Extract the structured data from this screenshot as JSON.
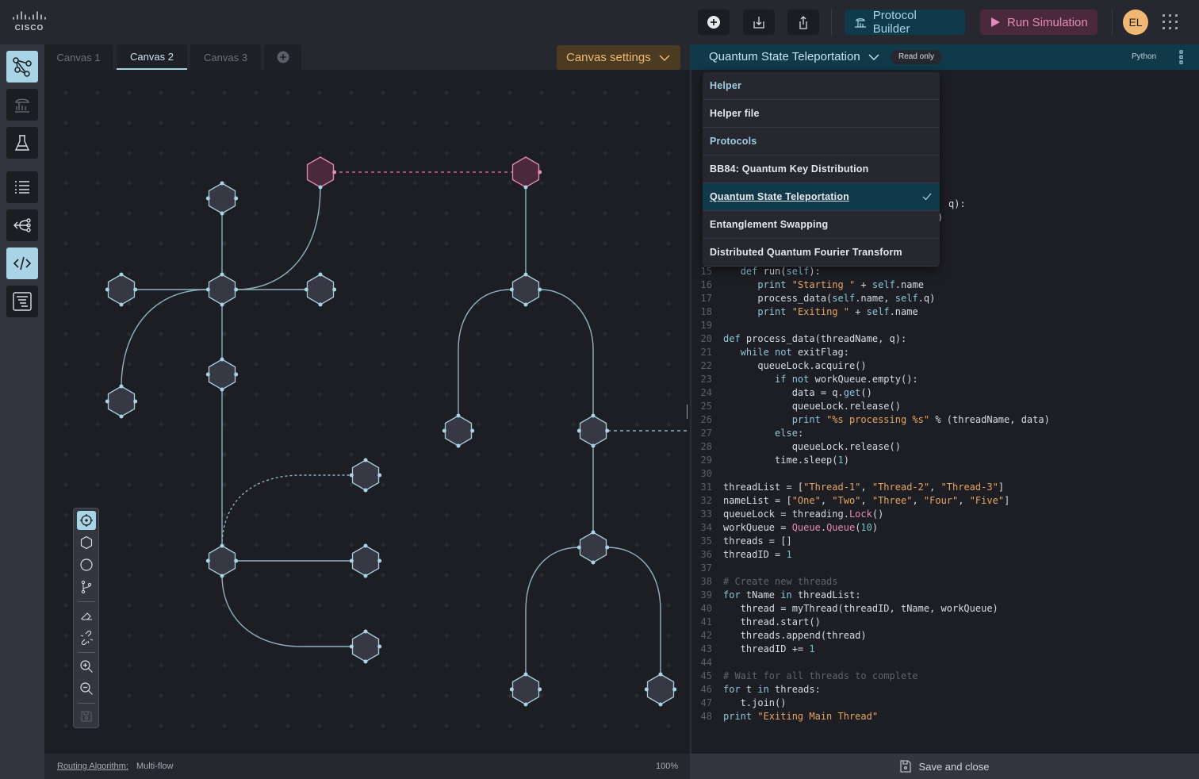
{
  "app": {
    "brand": "cisco"
  },
  "topbar": {
    "add_icon": "plus-circle-icon",
    "import_icon": "download-icon",
    "export_icon": "share-icon",
    "protocol_builder": "Protocol Builder",
    "run_simulation": "Run Simulation",
    "avatar_initials": "EL",
    "apps_icon": "grid-icon"
  },
  "colors": {
    "accent": "#a8d4e6",
    "protocol_bg": "#10394a",
    "run_bg": "#4a2a3a",
    "run_fg": "#e58bbb",
    "avatar": "#f0b872",
    "settings": "#f0b872"
  },
  "tabs": [
    {
      "label": "Canvas 1"
    },
    {
      "label": "Canvas 2",
      "active": true
    },
    {
      "label": "Canvas 3"
    }
  ],
  "canvas_settings": "Canvas settings",
  "rail": [
    "network-icon",
    "protocol-icon",
    "flask-icon",
    "list-icon",
    "branch-icon",
    "code-icon",
    "document-icon"
  ],
  "tools": [
    "target-icon",
    "hexagon-icon",
    "circle-icon",
    "branch-icon",
    "eraser-icon",
    "unlink-icon",
    "zoom-in-icon",
    "zoom-out-icon",
    "save-icon"
  ],
  "status": {
    "routing_label": "Routing Algorithm:",
    "routing_value": "Multi-flow",
    "zoom": "100%"
  },
  "editor": {
    "title": "Quantum State Teleportation",
    "badge": "Read only",
    "language": "Python",
    "dropdown": [
      {
        "label": "Helper",
        "header": true
      },
      {
        "label": "Helper file"
      },
      {
        "label": "Protocols",
        "header": true
      },
      {
        "label": "BB84: Quantum Key Distribution"
      },
      {
        "label": "Quantum State Teleportation",
        "selected": true
      },
      {
        "label": "Entanglement Swapping"
      },
      {
        "label": "Distributed Quantum Fourier Transform"
      }
    ],
    "obscured_fragments": [
      "q):",
      ")"
    ],
    "code": [
      {
        "n": "15",
        "t": [
          [
            "p",
            "   "
          ],
          [
            "k",
            "def"
          ],
          [
            "p",
            " run("
          ],
          [
            "k",
            "self"
          ],
          [
            "p",
            "):"
          ]
        ]
      },
      {
        "n": "16",
        "t": [
          [
            "p",
            "      "
          ],
          [
            "k",
            "print"
          ],
          [
            "p",
            " "
          ],
          [
            "s",
            "\"Starting \""
          ],
          [
            "p",
            " + "
          ],
          [
            "k",
            "self"
          ],
          [
            "p",
            ".name"
          ]
        ]
      },
      {
        "n": "17",
        "t": [
          [
            "p",
            "      process_data("
          ],
          [
            "k",
            "self"
          ],
          [
            "p",
            ".name, "
          ],
          [
            "k",
            "self"
          ],
          [
            "p",
            ".q)"
          ]
        ]
      },
      {
        "n": "18",
        "t": [
          [
            "p",
            "      "
          ],
          [
            "k",
            "print"
          ],
          [
            "p",
            " "
          ],
          [
            "s",
            "\"Exiting \""
          ],
          [
            "p",
            " + "
          ],
          [
            "k",
            "self"
          ],
          [
            "p",
            ".name"
          ]
        ]
      },
      {
        "n": "19",
        "t": []
      },
      {
        "n": "20",
        "t": [
          [
            "k",
            "def"
          ],
          [
            "p",
            " process_data(threadName, q):"
          ]
        ]
      },
      {
        "n": "21",
        "t": [
          [
            "p",
            "   "
          ],
          [
            "k",
            "while not"
          ],
          [
            "p",
            " exitFlag:"
          ]
        ]
      },
      {
        "n": "22",
        "t": [
          [
            "p",
            "      queueLock.acquire()"
          ]
        ]
      },
      {
        "n": "23",
        "t": [
          [
            "p",
            "         "
          ],
          [
            "k",
            "if not"
          ],
          [
            "p",
            " workQueue.empty():"
          ]
        ]
      },
      {
        "n": "24",
        "t": [
          [
            "p",
            "            data = q."
          ],
          [
            "k",
            "get"
          ],
          [
            "p",
            "()"
          ]
        ]
      },
      {
        "n": "25",
        "t": [
          [
            "p",
            "            queueLock.release()"
          ]
        ]
      },
      {
        "n": "26",
        "t": [
          [
            "p",
            "            "
          ],
          [
            "k",
            "print"
          ],
          [
            "p",
            " "
          ],
          [
            "s",
            "\"%s processing %s\""
          ],
          [
            "p",
            " % (threadName, data)"
          ]
        ]
      },
      {
        "n": "27",
        "t": [
          [
            "p",
            "         "
          ],
          [
            "k",
            "else"
          ],
          [
            "p",
            ":"
          ]
        ]
      },
      {
        "n": "28",
        "t": [
          [
            "p",
            "            queueLock.release()"
          ]
        ]
      },
      {
        "n": "29",
        "t": [
          [
            "p",
            "         time.sleep("
          ],
          [
            "n",
            "1"
          ],
          [
            "p",
            ")"
          ]
        ]
      },
      {
        "n": "30",
        "t": []
      },
      {
        "n": "31",
        "t": [
          [
            "p",
            "threadList = ["
          ],
          [
            "s",
            "\"Thread-1\""
          ],
          [
            "p",
            ", "
          ],
          [
            "s",
            "\"Thread-2\""
          ],
          [
            "p",
            ", "
          ],
          [
            "s",
            "\"Thread-3\""
          ],
          [
            "p",
            "]"
          ]
        ]
      },
      {
        "n": "32",
        "t": [
          [
            "p",
            "nameList = ["
          ],
          [
            "s",
            "\"One\""
          ],
          [
            "p",
            ", "
          ],
          [
            "s",
            "\"Two\""
          ],
          [
            "p",
            ", "
          ],
          [
            "s",
            "\"Three\""
          ],
          [
            "p",
            ", "
          ],
          [
            "s",
            "\"Four\""
          ],
          [
            "p",
            ", "
          ],
          [
            "s",
            "\"Five\""
          ],
          [
            "p",
            "]"
          ]
        ]
      },
      {
        "n": "33",
        "t": [
          [
            "p",
            "queueLock = threading."
          ],
          [
            "f",
            "Lock"
          ],
          [
            "p",
            "()"
          ]
        ]
      },
      {
        "n": "34",
        "t": [
          [
            "p",
            "workQueue = "
          ],
          [
            "f",
            "Queue"
          ],
          [
            "p",
            "."
          ],
          [
            "f",
            "Queue"
          ],
          [
            "p",
            "("
          ],
          [
            "n",
            "10"
          ],
          [
            "p",
            ")"
          ]
        ]
      },
      {
        "n": "35",
        "t": [
          [
            "p",
            "threads = []"
          ]
        ]
      },
      {
        "n": "36",
        "t": [
          [
            "p",
            "threadID = "
          ],
          [
            "n",
            "1"
          ]
        ]
      },
      {
        "n": "37",
        "t": []
      },
      {
        "n": "38",
        "t": [
          [
            "c",
            "# Create new threads"
          ]
        ]
      },
      {
        "n": "39",
        "t": [
          [
            "k",
            "for"
          ],
          [
            "p",
            " tName "
          ],
          [
            "k",
            "in"
          ],
          [
            "p",
            " threadList:"
          ]
        ]
      },
      {
        "n": "40",
        "t": [
          [
            "p",
            "   thread = myThread(threadID, tName, workQueue)"
          ]
        ]
      },
      {
        "n": "41",
        "t": [
          [
            "p",
            "   thread.start()"
          ]
        ]
      },
      {
        "n": "42",
        "t": [
          [
            "p",
            "   threads.append(thread)"
          ]
        ]
      },
      {
        "n": "43",
        "t": [
          [
            "p",
            "   threadID += "
          ],
          [
            "n",
            "1"
          ]
        ]
      },
      {
        "n": "44",
        "t": []
      },
      {
        "n": "45",
        "t": [
          [
            "c",
            "# Wait for all threads to complete"
          ]
        ]
      },
      {
        "n": "46",
        "t": [
          [
            "k",
            "for"
          ],
          [
            "p",
            " t "
          ],
          [
            "k",
            "in"
          ],
          [
            "p",
            " threads:"
          ]
        ]
      },
      {
        "n": "47",
        "t": [
          [
            "p",
            "   t.join()"
          ]
        ]
      },
      {
        "n": "48",
        "t": [
          [
            "k",
            "print"
          ],
          [
            "p",
            " "
          ],
          [
            "s",
            "\"Exiting Main Thread\""
          ]
        ]
      }
    ],
    "save_close": "Save and close"
  }
}
